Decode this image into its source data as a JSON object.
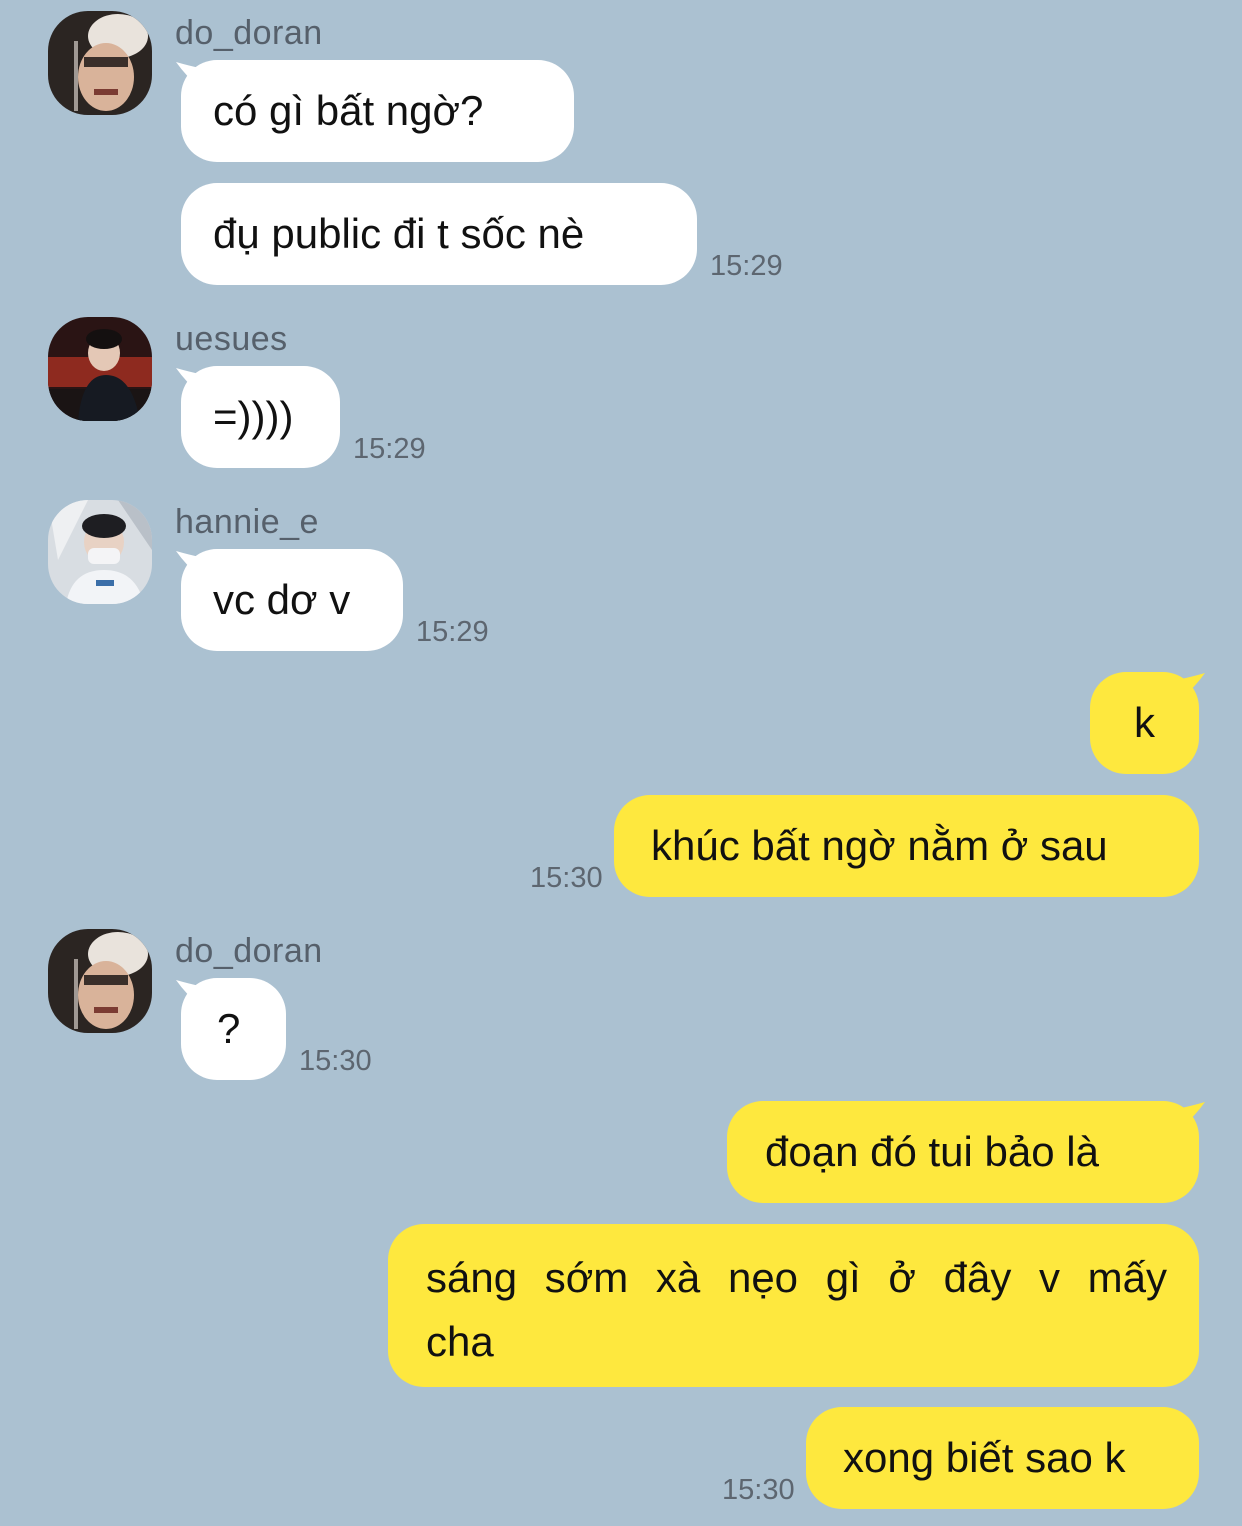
{
  "messages": [
    {
      "sender": "do_doran",
      "texts": [
        "có gì bất ngờ?",
        "đụ public đi t sốc nè"
      ],
      "time": "15:29"
    },
    {
      "sender": "uesues",
      "texts": [
        "=))))"
      ],
      "time": "15:29"
    },
    {
      "sender": "hannie_e",
      "texts": [
        "vc dơ v"
      ],
      "time": "15:29"
    },
    {
      "sender": "me",
      "texts": [
        "k",
        "khúc bất ngờ nằm ở sau"
      ],
      "time": "15:30"
    },
    {
      "sender": "do_doran",
      "texts": [
        "?"
      ],
      "time": "15:30"
    },
    {
      "sender": "me",
      "texts": [
        "đoạn đó tui bảo là",
        "sáng sớm xà nẹo gì ở đây v mấy cha",
        "xong biết sao k"
      ],
      "time": "15:30"
    }
  ],
  "colors": {
    "background": "#abc1d1",
    "incoming_bubble": "#ffffff",
    "outgoing_bubble": "#fee83e",
    "timestamp": "#5d6670",
    "sender_name": "#56606b"
  }
}
